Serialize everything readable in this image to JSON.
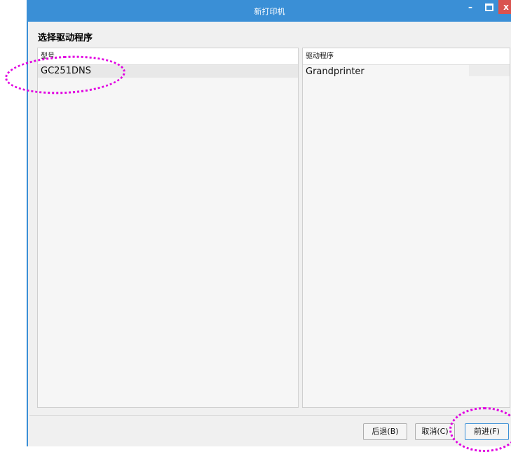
{
  "window": {
    "title": "新打印机",
    "controls": {
      "minimize": "–",
      "close": "x"
    }
  },
  "page": {
    "heading": "选择驱动程序"
  },
  "left_panel": {
    "header": "型号",
    "items": [
      "GC251DNS"
    ]
  },
  "right_panel": {
    "header": "驱动程序",
    "items": [
      "Grandprinter"
    ]
  },
  "footer": {
    "back_label": "后退(B)",
    "cancel_label": "取消(C)",
    "next_label": "前进(F)"
  },
  "annotation_color": "#e100e1",
  "accent_color": "#3a8fd6"
}
